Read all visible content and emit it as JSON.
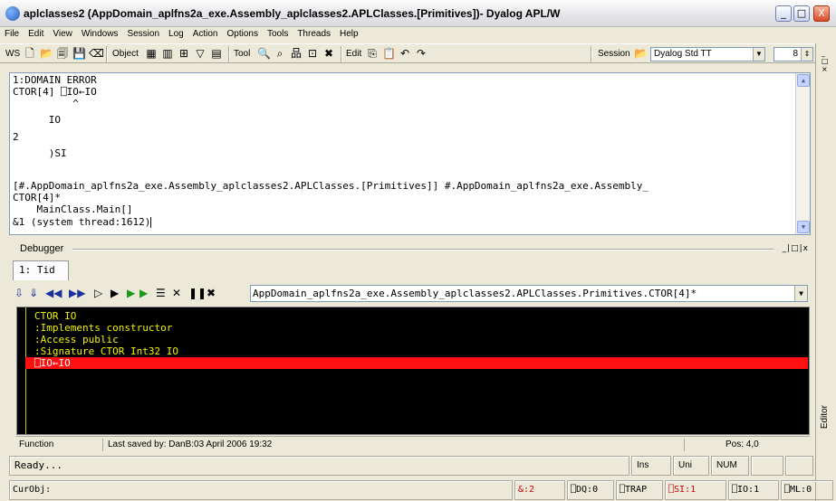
{
  "window": {
    "title": "aplclasses2 (AppDomain_aplfns2a_exe.Assembly_aplclasses2.APLClasses.[Primitives])- Dyalog APL/W",
    "minimize": "_",
    "maximize": "□",
    "close": "X"
  },
  "menu": [
    "File",
    "Edit",
    "View",
    "Windows",
    "Session",
    "Log",
    "Action",
    "Options",
    "Tools",
    "Threads",
    "Help"
  ],
  "toolbar": {
    "ws_label": "WS",
    "object_label": "Object",
    "tool_label": "Tool",
    "edit_label": "Edit",
    "session_label": "Session",
    "font_value": "Dyalog Std TT",
    "size_value": "8"
  },
  "session": {
    "lines": [
      "1:DOMAIN ERROR",
      "CTOR[4] ⎕IO←IO",
      "          ^",
      "      IO",
      "2",
      "      )SI",
      "",
      "[#.AppDomain_aplfns2a_exe.Assembly_aplclasses2.APLClasses.[Primitives]] #.AppDomain_aplfns2a_exe.Assembly_",
      "CTOR[4]*",
      "    MainClass.Main[]",
      "&1 (system thread:1612)"
    ]
  },
  "right_strip": {
    "editor_label": "Editor"
  },
  "debugger": {
    "label": "Debugger",
    "window_controls": "_|□|x",
    "tab_label": "1: Tid",
    "path": "AppDomain_aplfns2a_exe.Assembly_aplclasses2.APLClasses.Primitives.CTOR[4]*",
    "code_lines": [
      "CTOR IO",
      ":Implements constructor",
      ":Access public",
      ":Signature CTOR Int32 IO",
      "⎕IO←IO"
    ],
    "highlighted_line_index": 4,
    "status": {
      "mode": "Function",
      "saved": "Last saved by: DanB:03 April 2006 19:32",
      "pos": "Pos: 4,0"
    }
  },
  "statusbar": {
    "ready": "Ready...",
    "ins": "Ins",
    "uni": "Uni",
    "num": "NUM"
  },
  "bottombar": {
    "curobj": "CurObj:",
    "threads": "&:2",
    "dq": "⎕DQ:0",
    "trap": "⎕TRAP",
    "si": "⎕SI:1",
    "io": "⎕IO:1",
    "ml": "⎕ML:0"
  },
  "colors": {
    "highlight": "#ff1010",
    "code_text": "#f2f200",
    "si_alert": "#d40000"
  }
}
